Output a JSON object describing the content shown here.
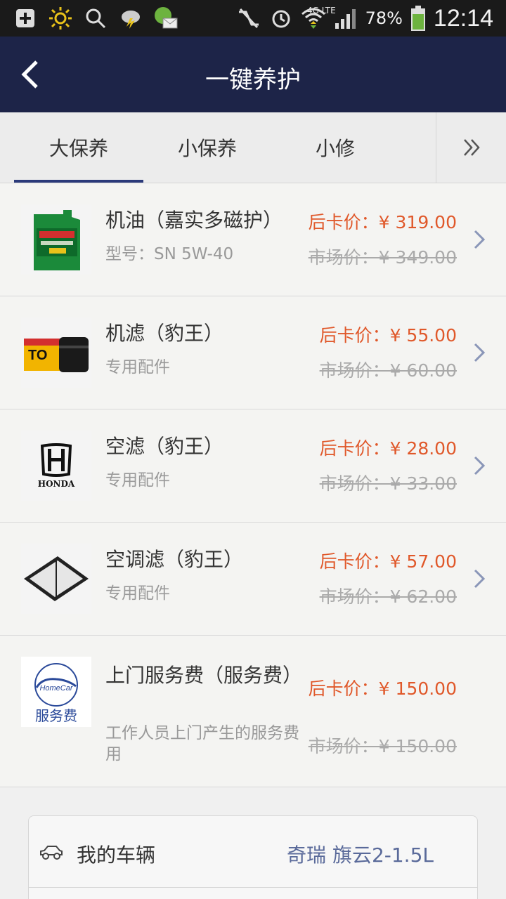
{
  "status_bar": {
    "network": "4G LTE",
    "battery": "78%",
    "time": "12:14",
    "icons": [
      "add-icon",
      "sun-icon",
      "search-icon",
      "weather-icon",
      "mail-icon",
      "mute-icon",
      "alarm-icon",
      "wifi-icon",
      "signal-icon",
      "battery-icon"
    ]
  },
  "header": {
    "title": "一键养护",
    "back_icon": "chevron-left-icon"
  },
  "tabs": [
    {
      "label": "大保养",
      "active": true
    },
    {
      "label": "小保养",
      "active": false
    },
    {
      "label": "小修",
      "active": false
    }
  ],
  "tabs_more_icon": "double-chevron-right-icon",
  "products": [
    {
      "name": "机油（嘉实多磁护）",
      "subtitle": "型号：SN 5W-40",
      "card_price": "后卡价：¥ 319.00",
      "market_price": "市场价：¥ 349.00",
      "image": "engine-oil-image"
    },
    {
      "name": "机滤（豹王）",
      "subtitle": "专用配件",
      "card_price": "后卡价：¥ 55.00",
      "market_price": "市场价：¥ 60.00",
      "image": "oil-filter-image"
    },
    {
      "name": "空滤（豹王）",
      "subtitle": "专用配件",
      "card_price": "后卡价：¥ 28.00",
      "market_price": "市场价：¥ 33.00",
      "image": "honda-logo-image",
      "image_text": "HONDA"
    },
    {
      "name": "空调滤（豹王）",
      "subtitle": "专用配件",
      "card_price": "后卡价：¥ 57.00",
      "market_price": "市场价：¥ 62.00",
      "image": "cabin-filter-image"
    },
    {
      "name": "上门服务费（服务费）",
      "subtitle": "工作人员上门产生的服务费用",
      "card_price": "后卡价：¥ 150.00",
      "market_price": "市场价：¥ 150.00",
      "image": "homecar-service-image",
      "image_text_top": "HomeCar",
      "image_text_bottom": "服务费"
    }
  ],
  "vehicle": {
    "label": "我的车辆",
    "value": "奇瑞 旗云2-1.5L",
    "icon": "car-icon"
  },
  "colors": {
    "header_bg": "#1d2448",
    "accent_price": "#e0582a",
    "tab_underline": "#2b3a7a"
  }
}
